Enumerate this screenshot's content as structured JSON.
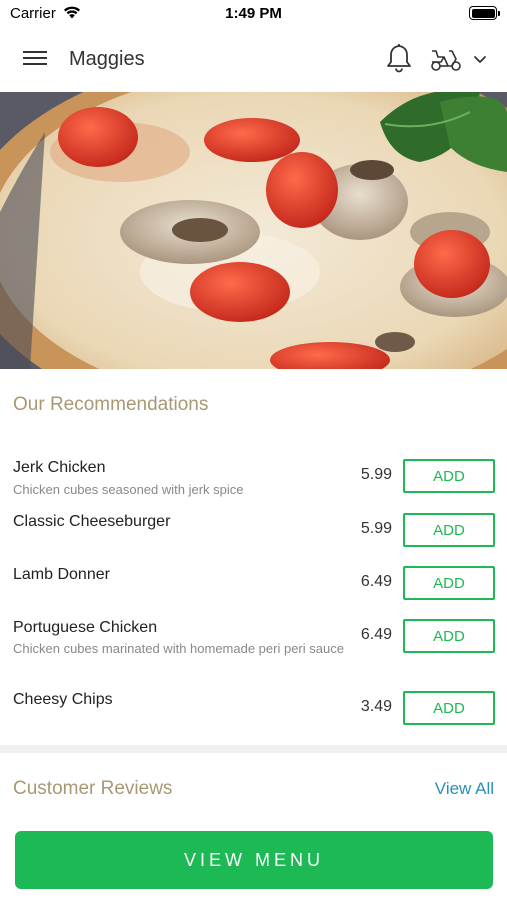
{
  "status_bar": {
    "carrier": "Carrier",
    "time": "1:49 PM"
  },
  "header": {
    "title": "Maggies",
    "icons": [
      "menu-icon",
      "bell-icon",
      "delivery-scooter-icon",
      "chevron-down-icon"
    ]
  },
  "hero": {
    "image": "pizza-photo"
  },
  "recommendations": {
    "title": "Our Recommendations",
    "items": [
      {
        "name": "Jerk Chicken",
        "description": "Chicken cubes seasoned with jerk spice",
        "price": "5.99",
        "button": "ADD"
      },
      {
        "name": "Classic Cheeseburger",
        "description": "",
        "price": "5.99",
        "button": "ADD"
      },
      {
        "name": "Lamb Donner",
        "description": "",
        "price": "6.49",
        "button": "ADD"
      },
      {
        "name": "Portuguese Chicken",
        "description": "Chicken cubes marinated with homemade peri peri sauce",
        "price": "6.49",
        "button": "ADD"
      },
      {
        "name": "Cheesy Chips",
        "description": "",
        "price": "3.49",
        "button": "ADD"
      }
    ]
  },
  "reviews": {
    "title": "Customer Reviews",
    "view_all": "View All"
  },
  "footer": {
    "view_menu": "VIEW MENU"
  },
  "colors": {
    "accent_green": "#1db954",
    "section_title": "#a89874",
    "link_blue": "#2a8fb8"
  }
}
